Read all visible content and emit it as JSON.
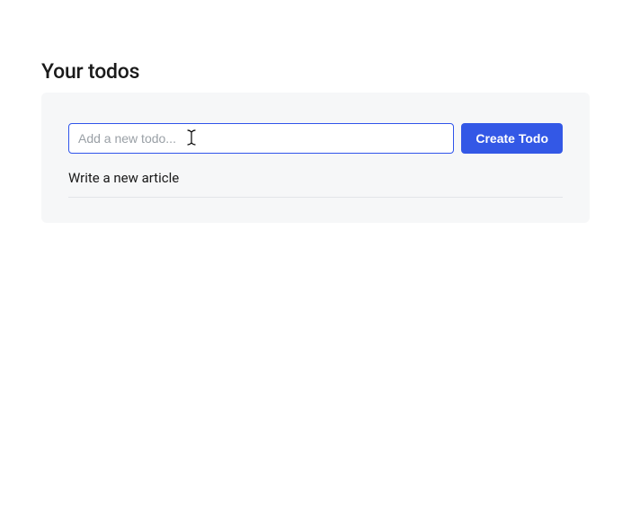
{
  "header": {
    "title": "Your todos"
  },
  "form": {
    "input_value": "",
    "input_placeholder": "Add a new todo...",
    "submit_label": "Create Todo"
  },
  "todos": {
    "items": [
      {
        "text": "Write a new article"
      }
    ]
  }
}
